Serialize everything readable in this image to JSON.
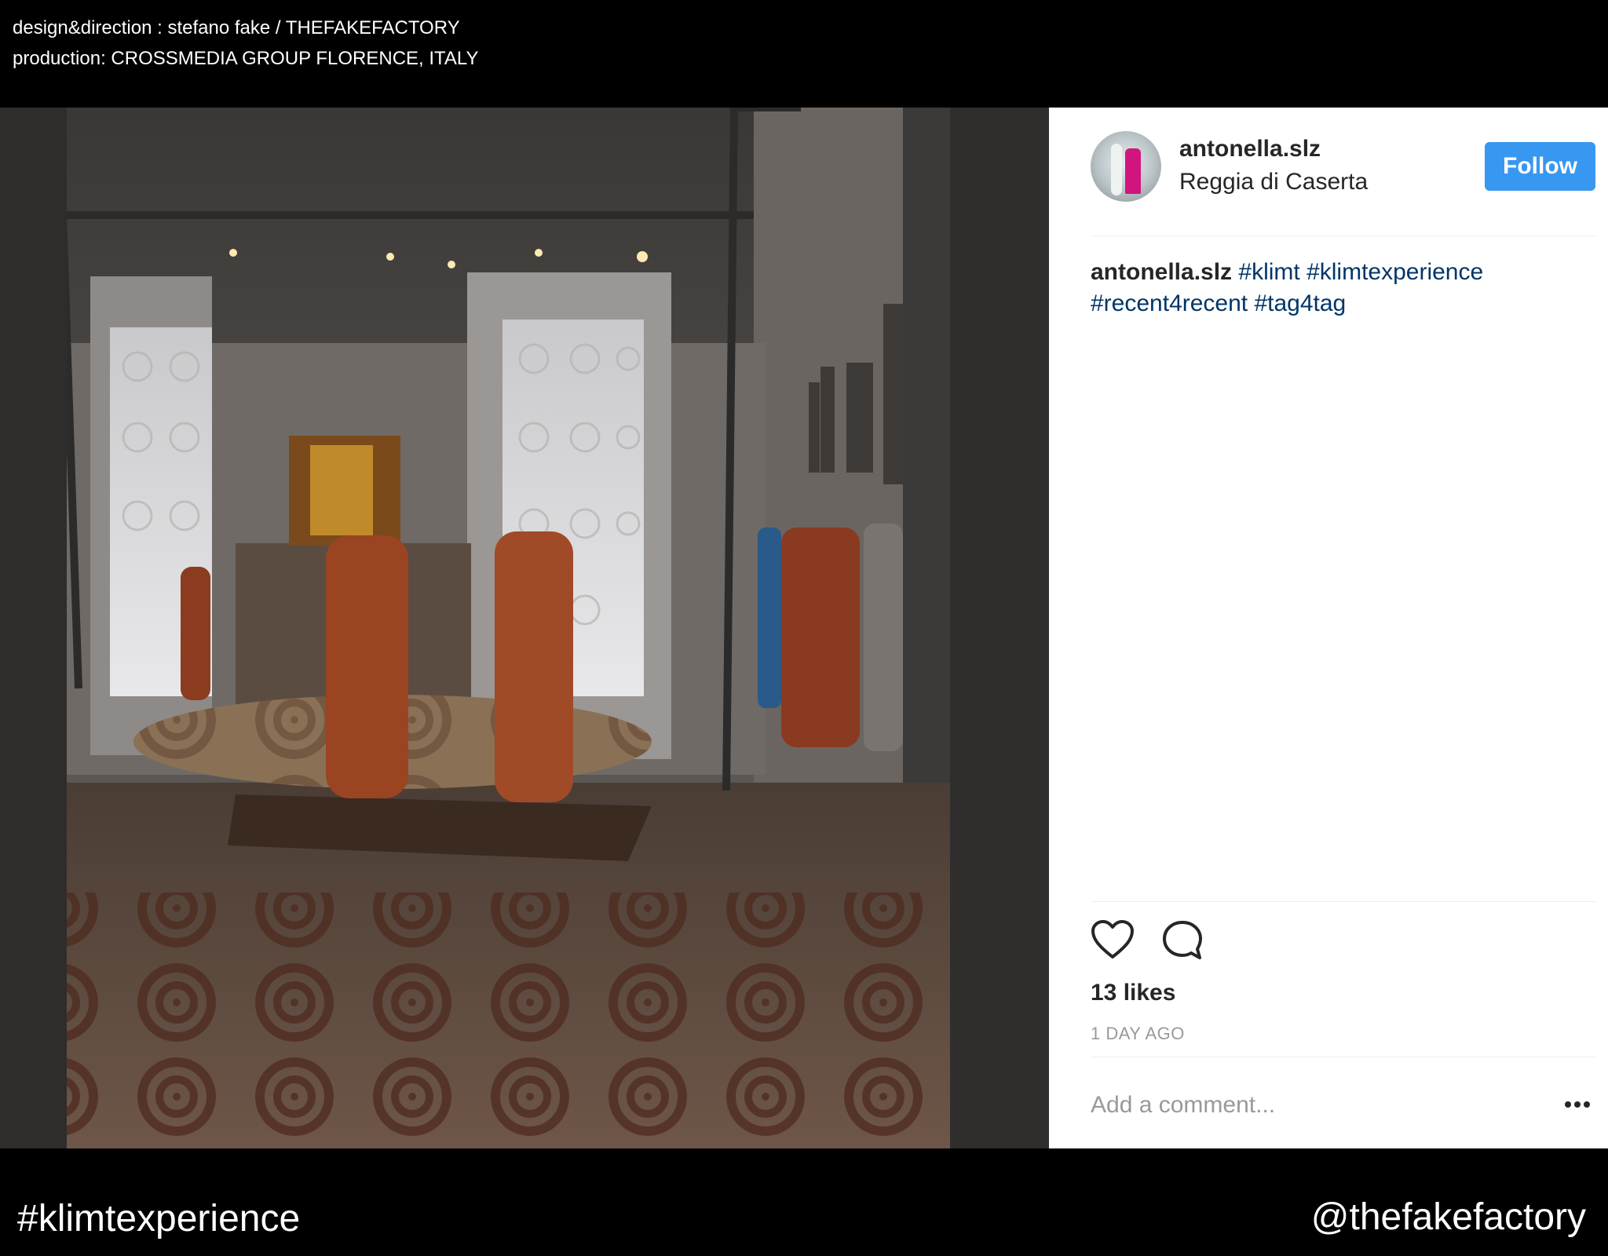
{
  "credits": {
    "line1": "design&direction : stefano fake / THEFAKEFACTORY",
    "line2": "production: CROSSMEDIA GROUP FLORENCE, ITALY"
  },
  "post": {
    "username": "antonella.slz",
    "location": "Reggia di Caserta",
    "follow_label": "Follow",
    "caption_user": "antonella.slz",
    "caption_tags_line1": "#klimt #klimtexperience",
    "caption_tags_line2": "#recent4recent #tag4tag",
    "likes": "13 likes",
    "time_ago": "1 DAY AGO",
    "comment_placeholder": "Add a comment..."
  },
  "icons": {
    "like": "heart-icon",
    "comment": "comment-bubble-icon",
    "more": "more-options-icon"
  },
  "colors": {
    "follow_button": "#3897f0",
    "hashtag": "#003569"
  },
  "footer": {
    "hashtag": "#klimtexperience",
    "handle": "@thefakefactory"
  }
}
